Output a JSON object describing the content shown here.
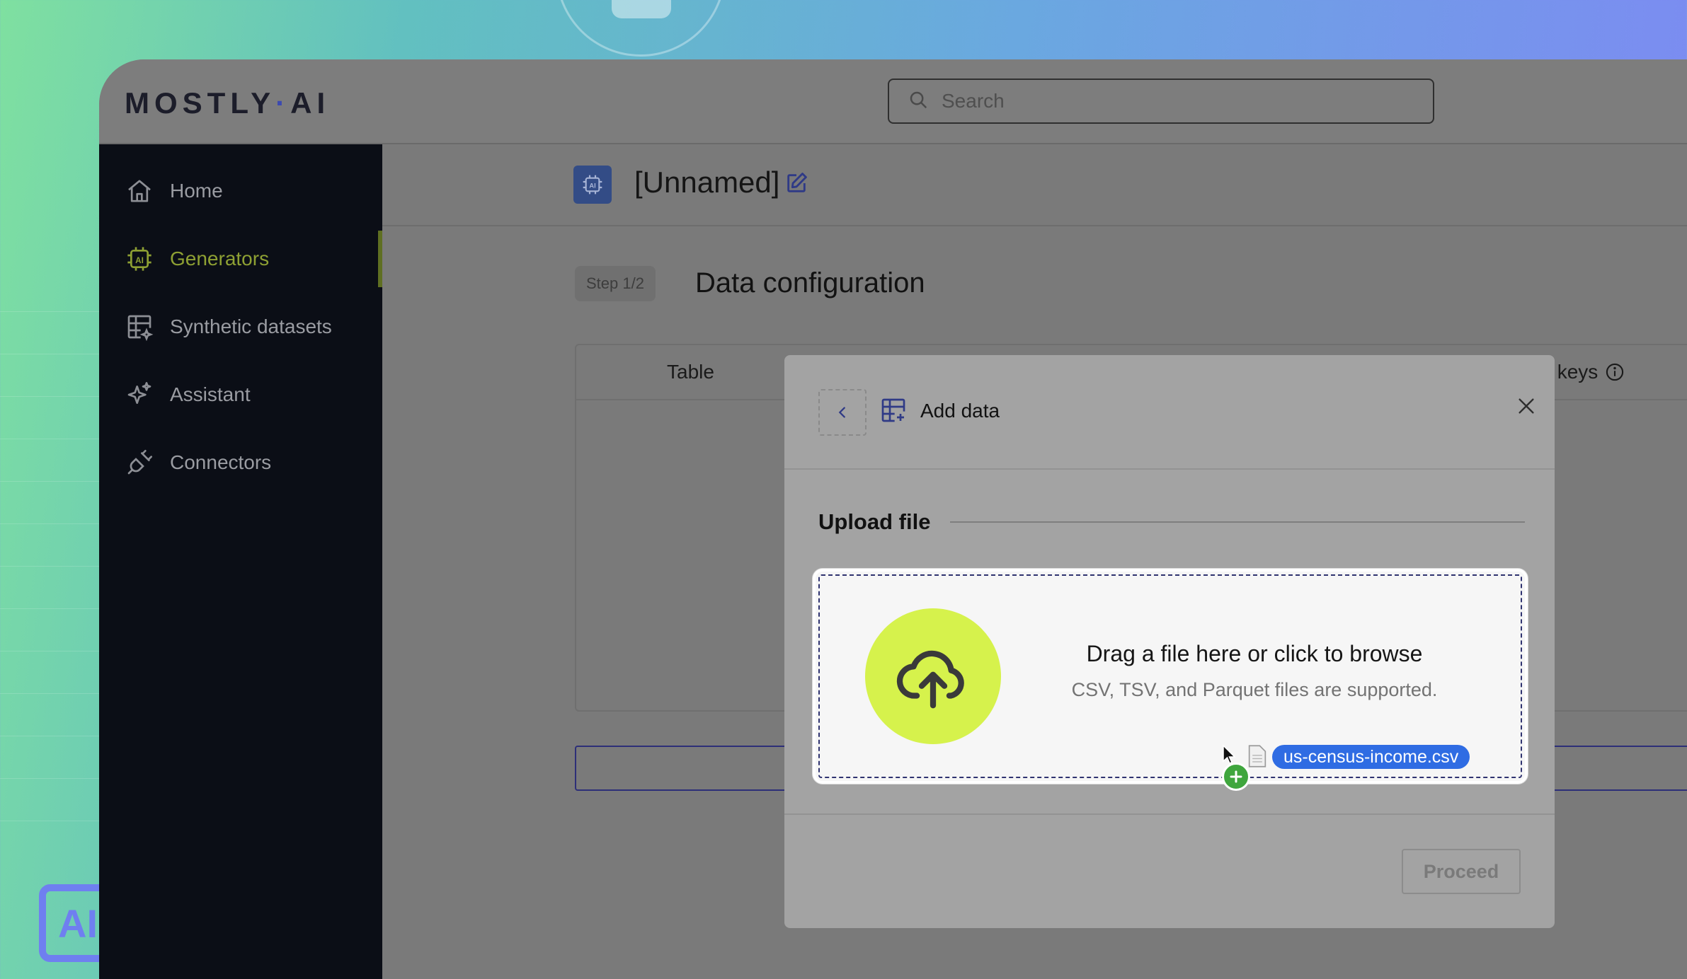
{
  "app": {
    "logo_left": "MOSTLY",
    "logo_dot": "·",
    "logo_right": "AI"
  },
  "search": {
    "placeholder": "Search",
    "icon": "search-icon"
  },
  "sidebar": {
    "items": [
      {
        "label": "Home",
        "icon": "home-icon",
        "active": false
      },
      {
        "label": "Generators",
        "icon": "ai-chip-icon",
        "active": true
      },
      {
        "label": "Synthetic datasets",
        "icon": "table-sparkle-icon",
        "active": false
      },
      {
        "label": "Assistant",
        "icon": "sparkle-icon",
        "active": false
      },
      {
        "label": "Connectors",
        "icon": "plug-icon",
        "active": false
      }
    ]
  },
  "header": {
    "title": "[Unnamed]",
    "badge_icon": "ai-chip-icon",
    "edit_icon": "edit-icon"
  },
  "config": {
    "step": "Step 1/2",
    "title": "Data configuration",
    "columns": {
      "table": "Table",
      "foreign_keys": "eign keys"
    }
  },
  "modal": {
    "title": "Add data",
    "section": "Upload file",
    "drop_title": "Drag a file here or click to browse",
    "drop_subtitle": "CSV, TSV, and Parquet files are supported.",
    "proceed": "Proceed"
  },
  "drag": {
    "file_name": "us-census-income.csv"
  },
  "colors": {
    "accent_lime": "#d6f24c",
    "active_nav": "#8ea033",
    "file_chip": "#2f6ce3",
    "badge_blue": "#334c86"
  }
}
